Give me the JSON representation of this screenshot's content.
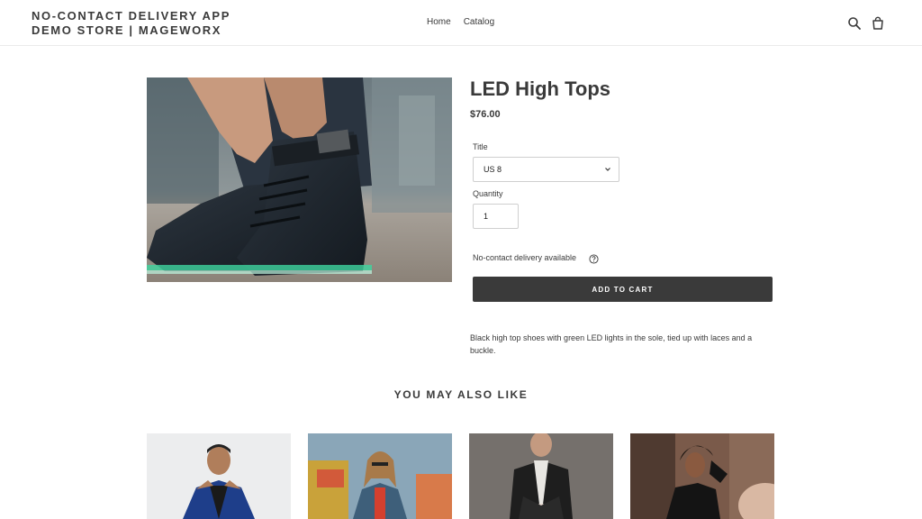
{
  "store": {
    "name_line1": "NO-CONTACT DELIVERY APP",
    "name_line2": "DEMO STORE | MAGEWORX"
  },
  "nav": {
    "items": [
      {
        "label": "Home"
      },
      {
        "label": "Catalog"
      }
    ]
  },
  "header_icons": [
    "search-icon",
    "cart-icon"
  ],
  "product": {
    "title": "LED High Tops",
    "price": "$76.00",
    "image_alt": "Black high top shoes with green LED soles",
    "option_label": "Title",
    "option_value": "US 8",
    "quantity_label": "Quantity",
    "quantity_value": "1",
    "delivery_note": "No-contact delivery available",
    "add_to_cart": "ADD TO CART",
    "description": "Black high top shoes with green LED lights in the sole, tied up with laces and a buckle."
  },
  "recommendations": {
    "heading": "YOU MAY ALSO LIKE"
  },
  "colors": {
    "text": "#3a3a3a",
    "button": "#3a3a3a",
    "border": "#cfcfcf"
  }
}
